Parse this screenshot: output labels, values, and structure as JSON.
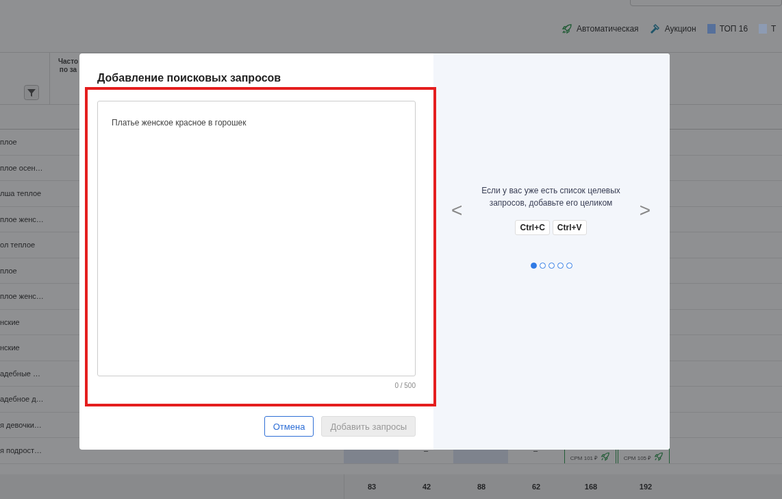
{
  "legend": [
    {
      "label": "Автоматическая",
      "kind": "rocket"
    },
    {
      "label": "Аукцион",
      "kind": "hammer"
    },
    {
      "label": "ТОП 16",
      "kind": "square",
      "color": "#56709b"
    },
    {
      "label": "Т",
      "kind": "square",
      "color": "#8d9bb3"
    }
  ],
  "table": {
    "header": [
      "Часто",
      "по за"
    ],
    "rows": [
      "плое",
      "плое осен…",
      "лша теплое",
      "плое женс…",
      "ол теплое",
      "плое",
      "плое женс…",
      "нские",
      "нские",
      "адебные …",
      "адебное д…",
      "я девочки…",
      "я подрост…"
    ],
    "last_row_cells": [
      {
        "shaded": false
      },
      {
        "shaded": false
      },
      {
        "shaded": false
      },
      {
        "shaded": false
      },
      {
        "shaded": false
      },
      {
        "shaded": true
      },
      {
        "text": "–",
        "shaded": false
      },
      {
        "shaded": true
      },
      {
        "text": "–",
        "shaded": false
      }
    ],
    "last_row_bids": [
      "CPM 101 ₽",
      "CPM 105 ₽"
    ],
    "totals": [
      "83",
      "42",
      "88",
      "62",
      "168",
      "192"
    ]
  },
  "modal": {
    "title": "Добавление поисковых запросов",
    "highlighted": true,
    "textarea": {
      "placeholder": "Платье женское красное в горошек",
      "counter": "0 / 500"
    },
    "buttons": [
      {
        "label": "Отмена",
        "disabled": false
      },
      {
        "label": "Добавить запросы",
        "disabled": true
      }
    ],
    "tip": {
      "text": "Если у вас уже есть список целевых запросов, добавьте его целиком",
      "keys": [
        "Ctrl+C",
        "Ctrl+V"
      ],
      "prev": "<",
      "next": ">",
      "dots": [
        {
          "selected": true
        },
        {
          "selected": false
        },
        {
          "selected": false
        },
        {
          "selected": false
        },
        {
          "selected": false
        }
      ]
    }
  }
}
